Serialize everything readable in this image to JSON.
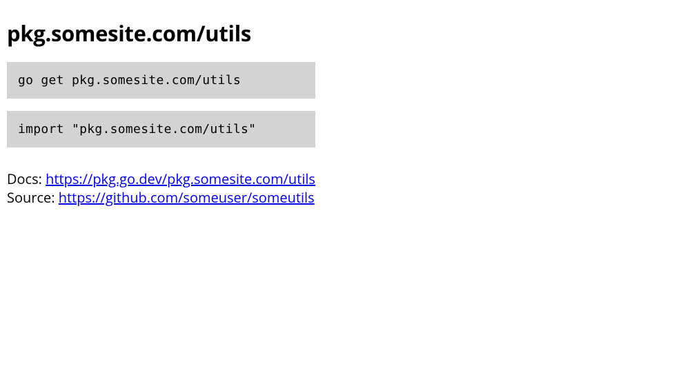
{
  "title": "pkg.somesite.com/utils",
  "commands": {
    "go_get": "go get pkg.somesite.com/utils",
    "import": "import \"pkg.somesite.com/utils\""
  },
  "links": {
    "docs_label": "Docs: ",
    "docs_url": "https://pkg.go.dev/pkg.somesite.com/utils",
    "source_label": "Source: ",
    "source_url": "https://github.com/someuser/someutils"
  }
}
